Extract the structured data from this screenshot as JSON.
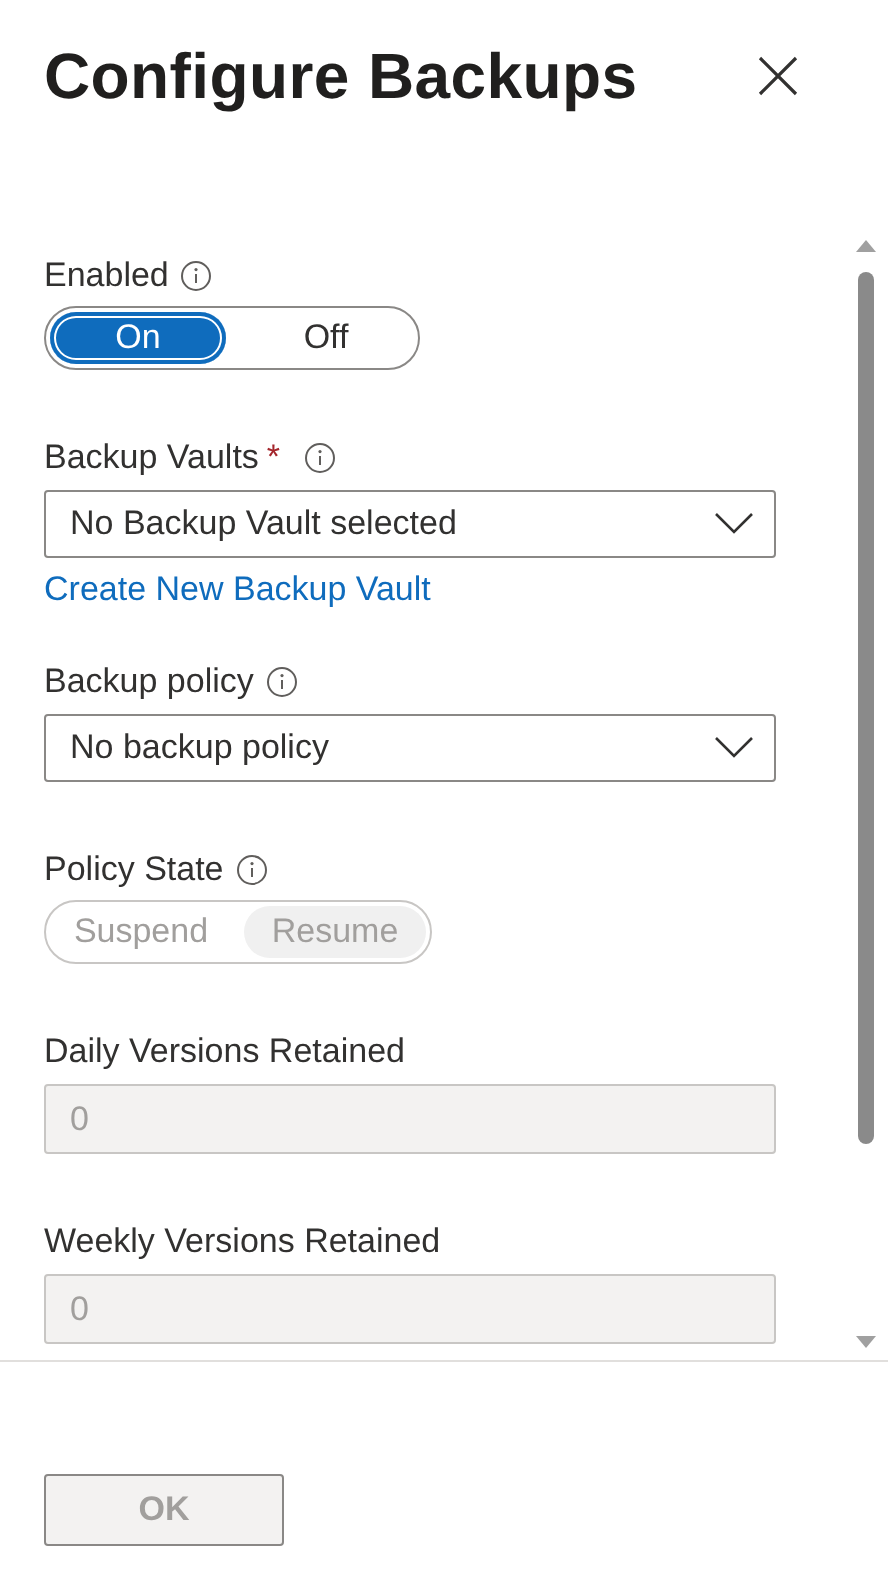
{
  "panel": {
    "title": "Configure Backups"
  },
  "fields": [
    {
      "kind": "toggle",
      "label": "Enabled",
      "info": true,
      "options": [
        {
          "label": "On",
          "selected": true
        },
        {
          "label": "Off",
          "selected": false
        }
      ]
    },
    {
      "kind": "dropdown",
      "label": "Backup Vaults",
      "required": "*",
      "info": true,
      "value": "No Backup Vault selected",
      "link": "Create New Backup Vault"
    },
    {
      "kind": "dropdown",
      "label": "Backup policy",
      "info": true,
      "value": "No backup policy"
    },
    {
      "kind": "segmented",
      "label": "Policy State",
      "info": true,
      "disabled": true,
      "options": [
        {
          "label": "Suspend",
          "selected": false
        },
        {
          "label": "Resume",
          "selected": true
        }
      ]
    },
    {
      "kind": "number",
      "label": "Daily Versions Retained",
      "disabled": true,
      "value": "0"
    },
    {
      "kind": "number",
      "label": "Weekly Versions Retained",
      "disabled": true,
      "value": "0"
    }
  ],
  "footer": {
    "ok_button": {
      "label": "OK",
      "disabled": true
    }
  }
}
